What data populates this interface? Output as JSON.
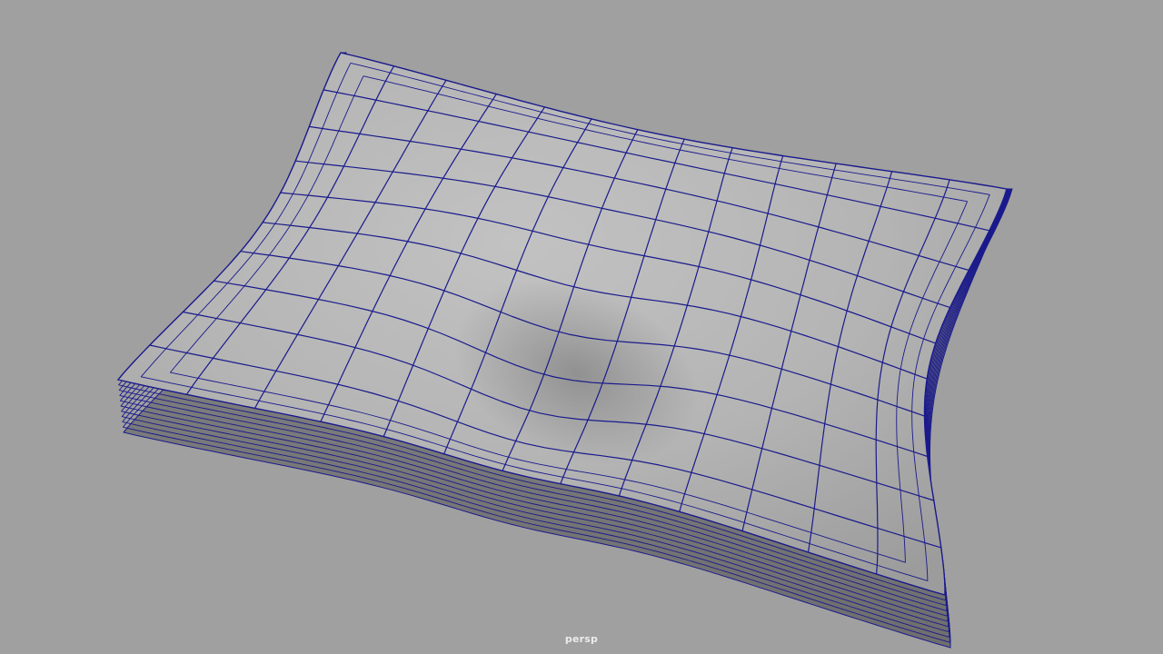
{
  "viewport": {
    "camera_name": "persp",
    "background_color": "#a0a0a0",
    "wireframe_color": "#1a1a8c",
    "surface_color": "#b0b0b0"
  },
  "scene": {
    "object": "pillow-mesh",
    "display_mode": "smooth-shaded-with-wireframe"
  }
}
